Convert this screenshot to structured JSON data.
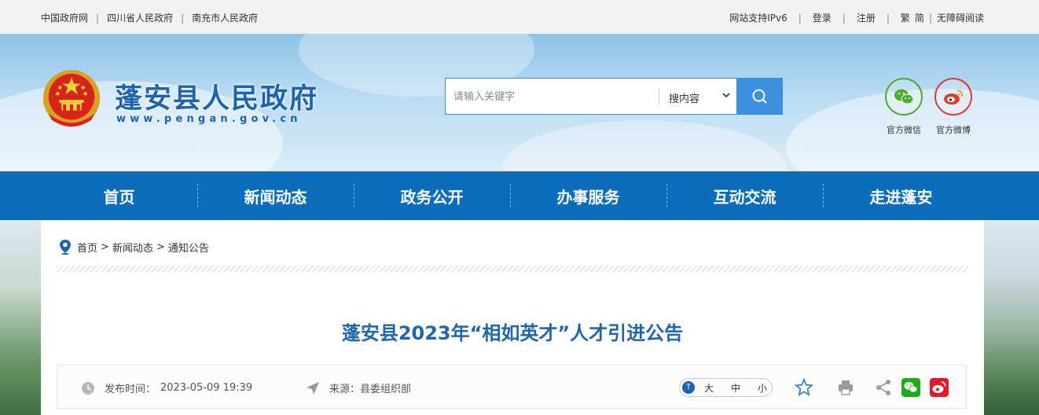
{
  "topbar": {
    "left_links": [
      "中国政府网",
      "四川省人民政府",
      "南充市人民政府"
    ],
    "ipv6": "网站支持IPv6",
    "login": "登录",
    "register": "注册",
    "trad": "繁",
    "simp": "简",
    "accessibility": "无障碍阅读"
  },
  "header": {
    "title": "蓬安县人民政府",
    "url": "www.pengan.gov.cn"
  },
  "search": {
    "placeholder": "请输入关键字",
    "scope": "搜内容"
  },
  "social": {
    "wechat": "官方微信",
    "weibo": "官方微博"
  },
  "nav": {
    "items": [
      "首页",
      "新闻动态",
      "政务公开",
      "办事服务",
      "互动交流",
      "走进蓬安"
    ],
    "active": "新闻动态"
  },
  "breadcrumb": {
    "home": "首页",
    "sep": ">",
    "level1": "新闻动态",
    "level2": "通知公告"
  },
  "article": {
    "title": "蓬安县2023年“相如英才”人才引进公告",
    "publish_label": "发布时间：",
    "publish_time": "2023-05-09 19:39",
    "source_label": "来源：",
    "source": "县委组织部"
  },
  "font_size": {
    "icon_text": "T",
    "large": "大",
    "medium": "中",
    "small": "小"
  },
  "colors": {
    "brand_blue": "#0d6dbd",
    "title_blue": "#1f67ad",
    "wechat_green": "#1aad19",
    "weibo_red": "#e6162d"
  },
  "icons": [
    "location-icon",
    "clock-icon",
    "source-arrow-icon",
    "star-icon",
    "print-icon",
    "share-icon",
    "wechat-icon",
    "weibo-icon",
    "search-icon",
    "chevron-down-icon"
  ]
}
